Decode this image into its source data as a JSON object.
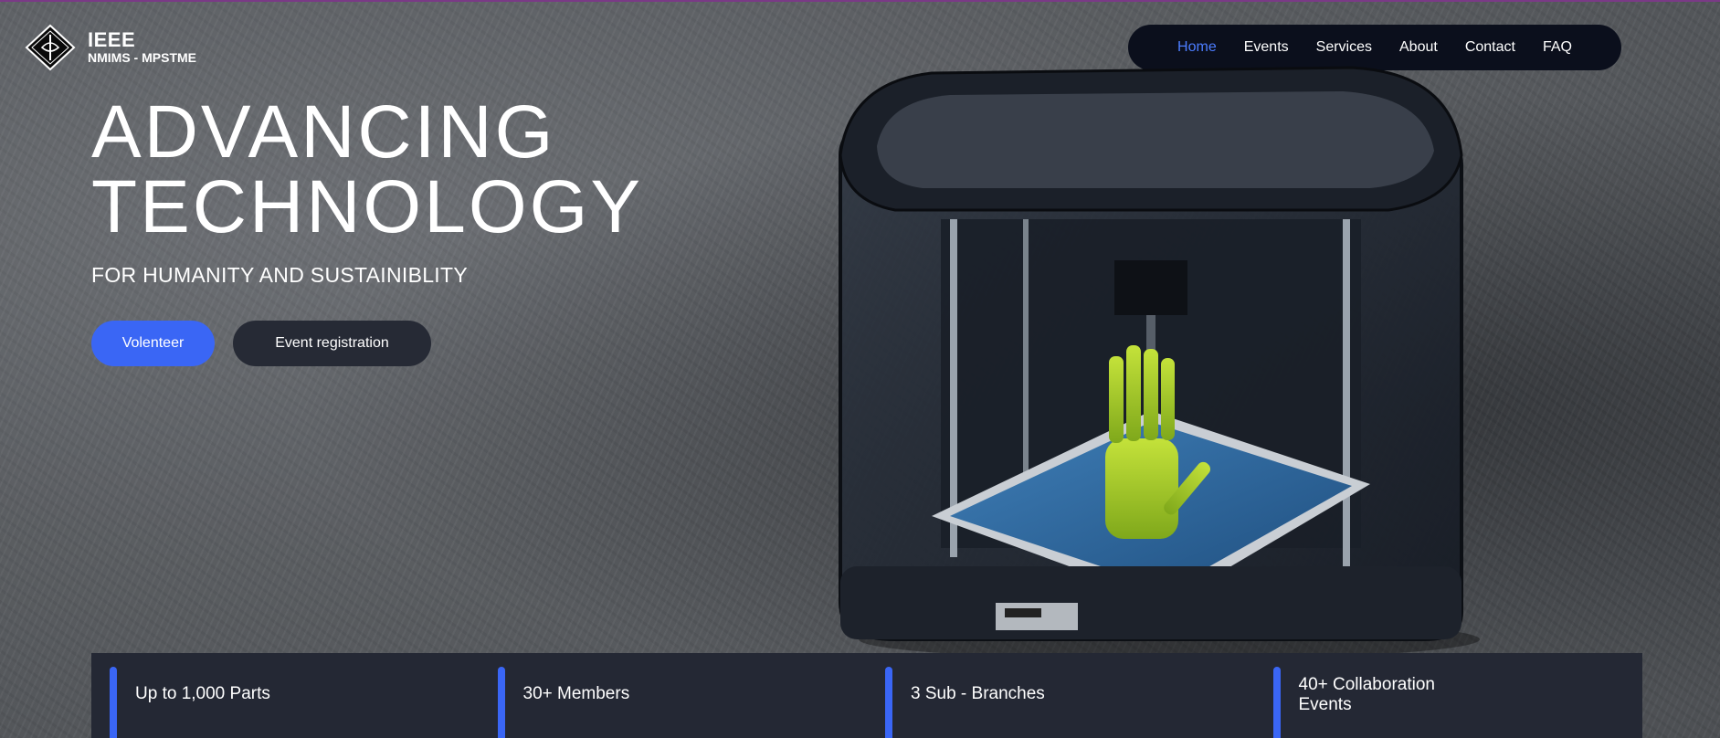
{
  "brand": {
    "title": "IEEE",
    "subtitle": "NMIMS - MPSTME",
    "logo_icon": "ieee-diamond-icon"
  },
  "nav": {
    "items": [
      {
        "label": "Home",
        "active": true
      },
      {
        "label": "Events",
        "active": false
      },
      {
        "label": "Services",
        "active": false
      },
      {
        "label": "About",
        "active": false
      },
      {
        "label": "Contact",
        "active": false
      },
      {
        "label": "FAQ",
        "active": false
      }
    ],
    "active_color": "#4c7dff"
  },
  "hero": {
    "headline_line1": "ADVANCING",
    "headline_line2": "TECHNOLOGY",
    "tagline": "FOR HUMANITY AND SUSTAINIBLITY",
    "primary_button": "Volenteer",
    "secondary_button": "Event registration",
    "image": "3d-printer-printing-hand"
  },
  "stats": [
    {
      "label": "Up to 1,000 Parts"
    },
    {
      "label": "30+ Members"
    },
    {
      "label": "3 Sub - Branches"
    },
    {
      "label": "40+ Collaboration Events"
    }
  ],
  "colors": {
    "accent": "#3a66f5",
    "nav_bg": "#0b0f1c",
    "stats_bg": "#242834"
  }
}
